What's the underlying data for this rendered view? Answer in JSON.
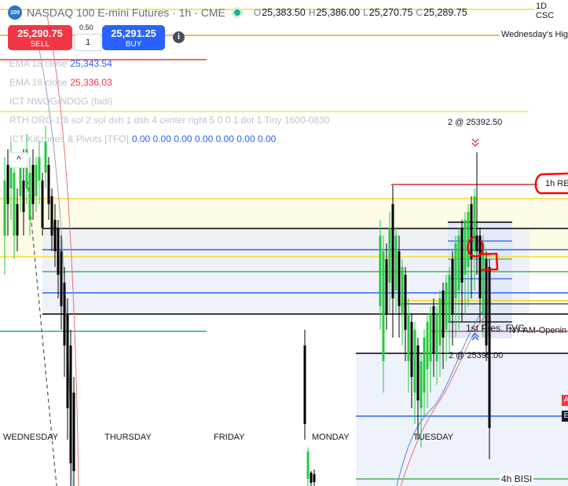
{
  "header": {
    "logo_text": "100",
    "symbol": "NASDAQ 100 E-mini Futures · 1h · CME",
    "ohlc": [
      {
        "key": "O",
        "value": "25,383.50"
      },
      {
        "key": "H",
        "value": "25,386.00"
      },
      {
        "key": "L",
        "value": "25,270.75"
      },
      {
        "key": "C",
        "value": "25,289.75"
      }
    ]
  },
  "trade": {
    "sell_price": "25,290.75",
    "sell_label": "SELL",
    "spread": "0.50",
    "quantity": "1",
    "buy_price": "25,291.25",
    "buy_label": "BUY"
  },
  "indicators": {
    "ema1_label": "EMA 18 close",
    "ema1_value": "25,343.54",
    "ema2_label": "EMA 18 close",
    "ema2_value": "25,336.03",
    "ict_nwog": "ICT NWOG/NDOG (fadi)",
    "rth": "RTH ORG 1/8 sol 2 sol dsh 1 dsh 4 center right 5 0 0 1 dot 1 Tiny 1600-0830",
    "killzones_label": "ICT Killzones & Pivots [TFO]",
    "killzones_values": "0.00 0.00 0.00 0.00 0.00 0.00 0.00"
  },
  "chart_labels": {
    "tag_1d": "1D CSC",
    "tag_wed": "Wednesday's Hig",
    "tag_1hre": "1h RE",
    "tag_4h": "4h BISI",
    "tag_nyam": "NY AM-Openin",
    "tag_fvg": "1st Pres. FVG",
    "ann_top": "2 @ 25392.50",
    "ann_mid": "2 @ 25395.00",
    "collapse_icon": "^",
    "badge_a": "A",
    "badge_e": "E"
  },
  "x_axis": [
    "WEDNESDAY",
    "THURSDAY",
    "FRIDAY",
    "MONDAY",
    "TUESDAY"
  ],
  "colors": {
    "bull": "#27c93f",
    "bear": "#000000",
    "sell": "#f23645",
    "buy": "#2962ff",
    "blue_level": "#2962ff",
    "yellow_level": "#f5dc3c",
    "orange_level": "#f0a020",
    "green_level": "#4caf50",
    "red_level": "#d32f2f",
    "teal_level": "#26a69a",
    "annotation_red": "#ff0000"
  }
}
